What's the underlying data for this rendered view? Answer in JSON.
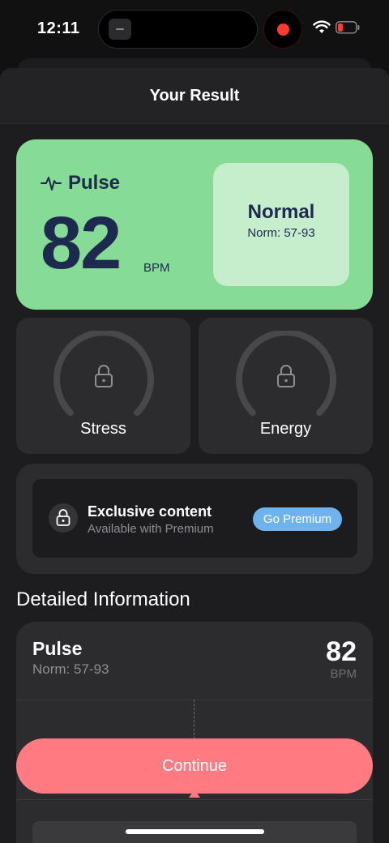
{
  "status_bar": {
    "time": "12:11"
  },
  "sheet": {
    "title": "Your Result"
  },
  "pulse_card": {
    "label": "Pulse",
    "value": "82",
    "unit": "BPM",
    "status": "Normal",
    "norm": "Norm: 57-93",
    "background_color": "#86dc96"
  },
  "gauges": [
    {
      "label": "Stress"
    },
    {
      "label": "Energy"
    }
  ],
  "premium": {
    "title": "Exclusive content",
    "subtitle": "Available with Premium",
    "button_label": "Go Premium",
    "button_color": "#6fb3ee"
  },
  "details": {
    "section_title": "Detailed Information",
    "name": "Pulse",
    "norm": "Norm: 57-93",
    "value": "82",
    "unit": "BPM"
  },
  "continue_button": {
    "label": "Continue",
    "color": "#ff7b81"
  }
}
